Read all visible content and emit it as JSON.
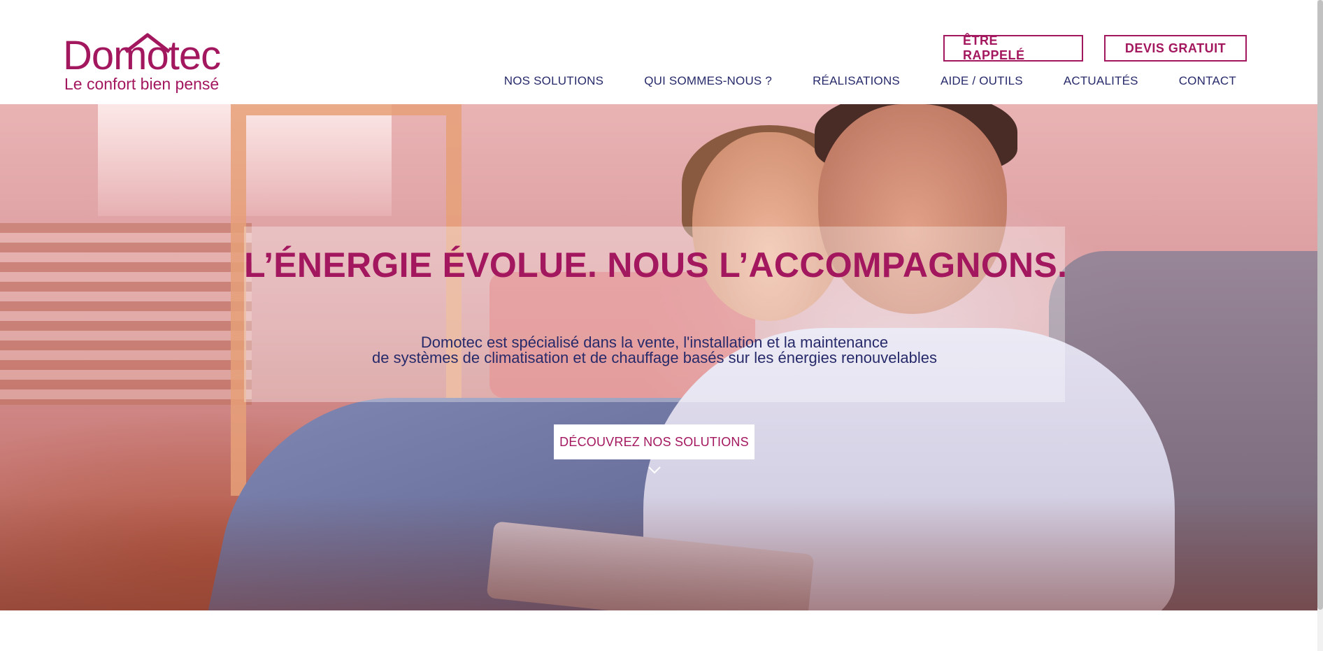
{
  "brand": {
    "logo_text_start": "Do",
    "logo_text_mid": "m",
    "logo_text_end": "otec",
    "tagline": "Le confort bien pensé",
    "primary_color": "#a3175f",
    "nav_color": "#272a6a"
  },
  "header": {
    "call_button": "ÊTRE RAPPELÉ",
    "quote_button": "DEVIS GRATUIT",
    "nav": [
      {
        "label": "NOS SOLUTIONS"
      },
      {
        "label": "QUI SOMMES-NOUS ?"
      },
      {
        "label": "RÉALISATIONS"
      },
      {
        "label": "AIDE / OUTILS"
      },
      {
        "label": "ACTUALITÉS"
      },
      {
        "label": "CONTACT"
      }
    ]
  },
  "hero": {
    "title": "L’ÉNERGIE ÉVOLUE. NOUS L’ACCOMPAGNONS.",
    "text_line1": "Domotec est spécialisé dans la vente, l'installation et la maintenance",
    "text_line2": "de systèmes de climatisation et de chauffage basés sur les énergies renouvelables",
    "cta": "DÉCOUVREZ NOS SOLUTIONS",
    "scroll_icon": "chevron-down-icon"
  }
}
